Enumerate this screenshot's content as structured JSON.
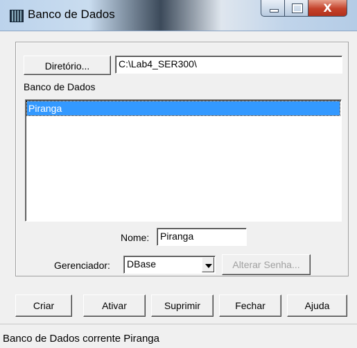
{
  "window": {
    "title": "Banco de Dados",
    "close_glyph": "X"
  },
  "directory": {
    "button_label": "Diretório...",
    "path": "C:\\Lab4_SER300\\"
  },
  "database_list": {
    "label": "Banco de Dados",
    "items": [
      "Piranga"
    ],
    "selected": "Piranga"
  },
  "name_field": {
    "label": "Nome:",
    "value": "Piranga"
  },
  "manager": {
    "label": "Gerenciador:",
    "value": "DBase",
    "change_password_label": "Alterar Senha..."
  },
  "actions": {
    "create": "Criar",
    "activate": "Ativar",
    "delete": "Suprimir",
    "close": "Fechar",
    "help": "Ajuda"
  },
  "status": {
    "text": "Banco de Dados corrente Piranga"
  }
}
